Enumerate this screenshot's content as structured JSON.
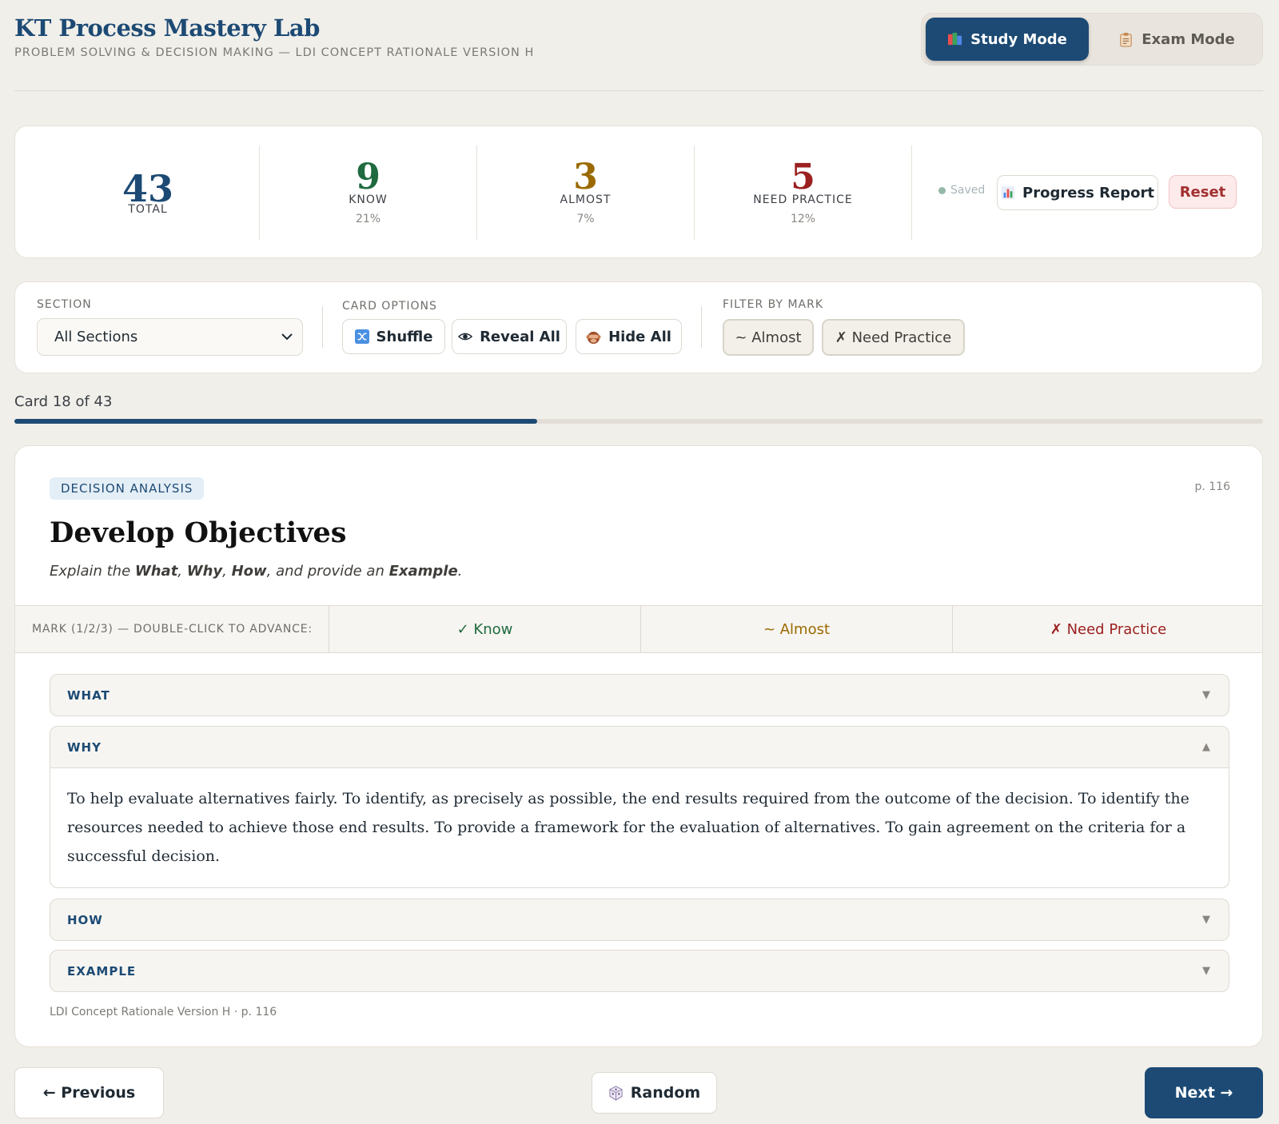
{
  "header": {
    "title": "KT Process Mastery Lab",
    "subtitle": "PROBLEM SOLVING & DECISION MAKING — LDI CONCEPT RATIONALE VERSION H",
    "modes": [
      {
        "label": "Study Mode",
        "icon": "books-icon",
        "active": true
      },
      {
        "label": "Exam Mode",
        "icon": "clipboard-icon",
        "active": false
      }
    ]
  },
  "stats": {
    "total": {
      "value": "43",
      "label": "TOTAL"
    },
    "know": {
      "value": "9",
      "label": "KNOW",
      "percent": "21%",
      "color": "#1f6a3f"
    },
    "almost": {
      "value": "3",
      "label": "ALMOST",
      "percent": "7%",
      "color": "#9a6a00"
    },
    "need_practice": {
      "value": "5",
      "label": "NEED PRACTICE",
      "percent": "12%",
      "color": "#9b2020"
    },
    "saved_label": "Saved",
    "progress_report_label": "Progress Report",
    "reset_label": "Reset"
  },
  "toolbar": {
    "section_label": "SECTION",
    "section_value": "All Sections",
    "card_options_label": "CARD OPTIONS",
    "shuffle_label": "Shuffle",
    "reveal_all_label": "Reveal All",
    "hide_all_label": "Hide All",
    "filter_label": "FILTER BY MARK",
    "filter_almost_label": "~ Almost",
    "filter_need_label": "✗ Need Practice"
  },
  "progress": {
    "counter_text": "Card 18 of 43",
    "current": 18,
    "total": 43
  },
  "card": {
    "category": "DECISION ANALYSIS",
    "page": "p. 116",
    "title": "Develop Objectives",
    "prompt_prefix": "Explain the ",
    "prompt_what": "What",
    "prompt_sep1": ", ",
    "prompt_why": "Why",
    "prompt_sep2": ", ",
    "prompt_how": "How",
    "prompt_sep3": ", and provide an ",
    "prompt_example": "Example",
    "prompt_suffix": ".",
    "mark_label": "MARK (1/2/3) — DOUBLE-CLICK TO ADVANCE:",
    "mark_know": "✓ Know",
    "mark_almost": "~ Almost",
    "mark_need": "✗ Need Practice",
    "sections": {
      "what": {
        "label": "WHAT",
        "arrow": "▼"
      },
      "why": {
        "label": "WHY",
        "arrow": "▲",
        "body": "To help evaluate alternatives fairly. To identify, as precisely as possible, the end results required from the outcome of the decision. To identify the resources needed to achieve those end results. To provide a framework for the evaluation of alternatives. To gain agreement on the criteria for a successful decision."
      },
      "how": {
        "label": "HOW",
        "arrow": "▼"
      },
      "example": {
        "label": "EXAMPLE",
        "arrow": "▼"
      }
    },
    "source": "LDI Concept Rationale Version H · p. 116"
  },
  "nav": {
    "previous_label": "← Previous",
    "random_label": "Random",
    "next_label": "Next →"
  },
  "colors": {
    "accent": "#1c4a74",
    "know": "#1f6a3f",
    "almost": "#9a6a00",
    "need_practice": "#9b2020"
  }
}
